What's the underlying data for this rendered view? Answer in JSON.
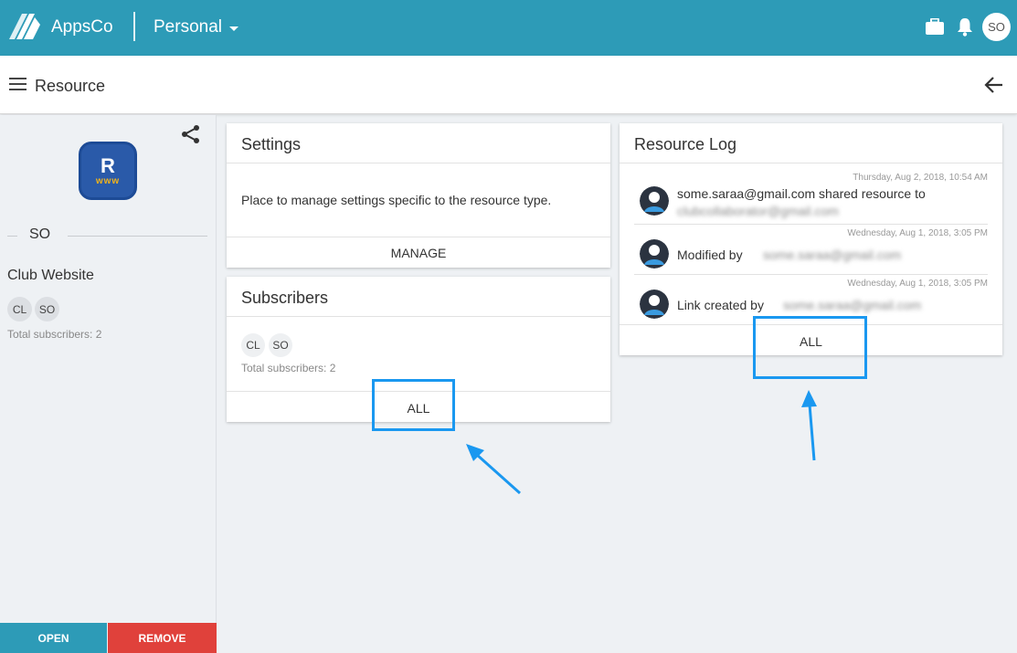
{
  "topbar": {
    "brand": "AppsCo",
    "context": "Personal",
    "user_initials": "SO",
    "icons": [
      "logo-icon",
      "briefcase-icon",
      "bell-icon",
      "chevron-down-icon"
    ]
  },
  "subheader": {
    "title": "Resource",
    "icons": [
      "menu-icon",
      "back-arrow-icon"
    ]
  },
  "sidebar": {
    "resource_icon_letter": "R",
    "resource_icon_sub": "www",
    "owner": "SO",
    "resource_name": "Club Website",
    "subscribers": [
      "CL",
      "SO"
    ],
    "total_subscribers": "Total subscribers: 2",
    "open_label": "OPEN",
    "remove_label": "REMOVE",
    "colors": {
      "open": "#2d9bb7",
      "remove": "#e0413b"
    }
  },
  "settings_card": {
    "title": "Settings",
    "description": "Place to manage settings specific to the resource type.",
    "action": "MANAGE"
  },
  "subscribers_card": {
    "title": "Subscribers",
    "subscribers": [
      "CL",
      "SO"
    ],
    "total": "Total subscribers: 2",
    "action": "ALL"
  },
  "log_card": {
    "title": "Resource Log",
    "items": [
      {
        "date": "Thursday, Aug 2, 2018, 10:54 AM",
        "text": "some.saraa@gmail.com shared resource to",
        "blurred": "clubcollaborator@gmail.com"
      },
      {
        "date": "Wednesday, Aug 1, 2018, 3:05 PM",
        "text": "Modified by",
        "blurred": "some.saraa@gmail.com"
      },
      {
        "date": "Wednesday, Aug 1, 2018, 3:05 PM",
        "text": "Link created by",
        "blurred": "some.saraa@gmail.com"
      }
    ],
    "action": "ALL"
  },
  "theme": {
    "primary": "#2d9bb7",
    "highlight": "#1a98f0"
  }
}
